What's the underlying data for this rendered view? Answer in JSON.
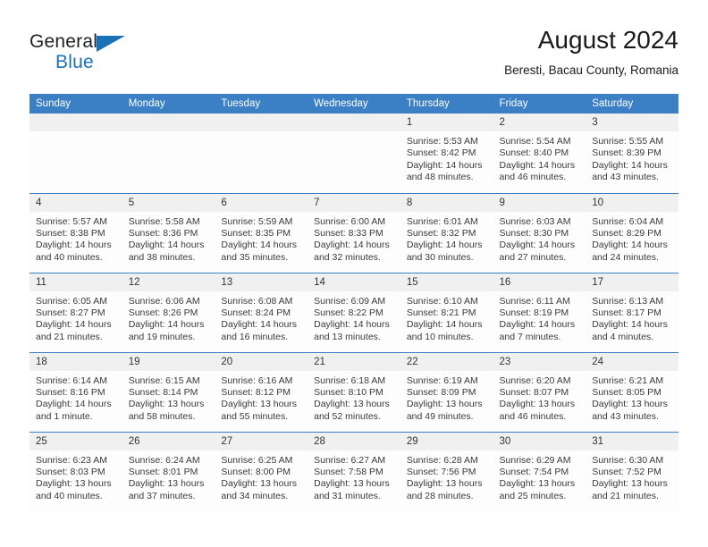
{
  "brand": {
    "name_part1": "General",
    "name_part2": "Blue",
    "accent_color": "#1b72b8"
  },
  "header": {
    "title": "August 2024",
    "subtitle": "Beresti, Bacau County, Romania"
  },
  "calendar": {
    "header_bg": "#3b7fc4",
    "daynum_bg": "#f0f0f0",
    "weekday_headers": [
      "Sunday",
      "Monday",
      "Tuesday",
      "Wednesday",
      "Thursday",
      "Friday",
      "Saturday"
    ],
    "weeks": [
      [
        {
          "day": "",
          "sunrise": "",
          "sunset": "",
          "daylight_line1": "",
          "daylight_line2": ""
        },
        {
          "day": "",
          "sunrise": "",
          "sunset": "",
          "daylight_line1": "",
          "daylight_line2": ""
        },
        {
          "day": "",
          "sunrise": "",
          "sunset": "",
          "daylight_line1": "",
          "daylight_line2": ""
        },
        {
          "day": "",
          "sunrise": "",
          "sunset": "",
          "daylight_line1": "",
          "daylight_line2": ""
        },
        {
          "day": "1",
          "sunrise": "Sunrise: 5:53 AM",
          "sunset": "Sunset: 8:42 PM",
          "daylight_line1": "Daylight: 14 hours",
          "daylight_line2": "and 48 minutes."
        },
        {
          "day": "2",
          "sunrise": "Sunrise: 5:54 AM",
          "sunset": "Sunset: 8:40 PM",
          "daylight_line1": "Daylight: 14 hours",
          "daylight_line2": "and 46 minutes."
        },
        {
          "day": "3",
          "sunrise": "Sunrise: 5:55 AM",
          "sunset": "Sunset: 8:39 PM",
          "daylight_line1": "Daylight: 14 hours",
          "daylight_line2": "and 43 minutes."
        }
      ],
      [
        {
          "day": "4",
          "sunrise": "Sunrise: 5:57 AM",
          "sunset": "Sunset: 8:38 PM",
          "daylight_line1": "Daylight: 14 hours",
          "daylight_line2": "and 40 minutes."
        },
        {
          "day": "5",
          "sunrise": "Sunrise: 5:58 AM",
          "sunset": "Sunset: 8:36 PM",
          "daylight_line1": "Daylight: 14 hours",
          "daylight_line2": "and 38 minutes."
        },
        {
          "day": "6",
          "sunrise": "Sunrise: 5:59 AM",
          "sunset": "Sunset: 8:35 PM",
          "daylight_line1": "Daylight: 14 hours",
          "daylight_line2": "and 35 minutes."
        },
        {
          "day": "7",
          "sunrise": "Sunrise: 6:00 AM",
          "sunset": "Sunset: 8:33 PM",
          "daylight_line1": "Daylight: 14 hours",
          "daylight_line2": "and 32 minutes."
        },
        {
          "day": "8",
          "sunrise": "Sunrise: 6:01 AM",
          "sunset": "Sunset: 8:32 PM",
          "daylight_line1": "Daylight: 14 hours",
          "daylight_line2": "and 30 minutes."
        },
        {
          "day": "9",
          "sunrise": "Sunrise: 6:03 AM",
          "sunset": "Sunset: 8:30 PM",
          "daylight_line1": "Daylight: 14 hours",
          "daylight_line2": "and 27 minutes."
        },
        {
          "day": "10",
          "sunrise": "Sunrise: 6:04 AM",
          "sunset": "Sunset: 8:29 PM",
          "daylight_line1": "Daylight: 14 hours",
          "daylight_line2": "and 24 minutes."
        }
      ],
      [
        {
          "day": "11",
          "sunrise": "Sunrise: 6:05 AM",
          "sunset": "Sunset: 8:27 PM",
          "daylight_line1": "Daylight: 14 hours",
          "daylight_line2": "and 21 minutes."
        },
        {
          "day": "12",
          "sunrise": "Sunrise: 6:06 AM",
          "sunset": "Sunset: 8:26 PM",
          "daylight_line1": "Daylight: 14 hours",
          "daylight_line2": "and 19 minutes."
        },
        {
          "day": "13",
          "sunrise": "Sunrise: 6:08 AM",
          "sunset": "Sunset: 8:24 PM",
          "daylight_line1": "Daylight: 14 hours",
          "daylight_line2": "and 16 minutes."
        },
        {
          "day": "14",
          "sunrise": "Sunrise: 6:09 AM",
          "sunset": "Sunset: 8:22 PM",
          "daylight_line1": "Daylight: 14 hours",
          "daylight_line2": "and 13 minutes."
        },
        {
          "day": "15",
          "sunrise": "Sunrise: 6:10 AM",
          "sunset": "Sunset: 8:21 PM",
          "daylight_line1": "Daylight: 14 hours",
          "daylight_line2": "and 10 minutes."
        },
        {
          "day": "16",
          "sunrise": "Sunrise: 6:11 AM",
          "sunset": "Sunset: 8:19 PM",
          "daylight_line1": "Daylight: 14 hours",
          "daylight_line2": "and 7 minutes."
        },
        {
          "day": "17",
          "sunrise": "Sunrise: 6:13 AM",
          "sunset": "Sunset: 8:17 PM",
          "daylight_line1": "Daylight: 14 hours",
          "daylight_line2": "and 4 minutes."
        }
      ],
      [
        {
          "day": "18",
          "sunrise": "Sunrise: 6:14 AM",
          "sunset": "Sunset: 8:16 PM",
          "daylight_line1": "Daylight: 14 hours",
          "daylight_line2": "and 1 minute."
        },
        {
          "day": "19",
          "sunrise": "Sunrise: 6:15 AM",
          "sunset": "Sunset: 8:14 PM",
          "daylight_line1": "Daylight: 13 hours",
          "daylight_line2": "and 58 minutes."
        },
        {
          "day": "20",
          "sunrise": "Sunrise: 6:16 AM",
          "sunset": "Sunset: 8:12 PM",
          "daylight_line1": "Daylight: 13 hours",
          "daylight_line2": "and 55 minutes."
        },
        {
          "day": "21",
          "sunrise": "Sunrise: 6:18 AM",
          "sunset": "Sunset: 8:10 PM",
          "daylight_line1": "Daylight: 13 hours",
          "daylight_line2": "and 52 minutes."
        },
        {
          "day": "22",
          "sunrise": "Sunrise: 6:19 AM",
          "sunset": "Sunset: 8:09 PM",
          "daylight_line1": "Daylight: 13 hours",
          "daylight_line2": "and 49 minutes."
        },
        {
          "day": "23",
          "sunrise": "Sunrise: 6:20 AM",
          "sunset": "Sunset: 8:07 PM",
          "daylight_line1": "Daylight: 13 hours",
          "daylight_line2": "and 46 minutes."
        },
        {
          "day": "24",
          "sunrise": "Sunrise: 6:21 AM",
          "sunset": "Sunset: 8:05 PM",
          "daylight_line1": "Daylight: 13 hours",
          "daylight_line2": "and 43 minutes."
        }
      ],
      [
        {
          "day": "25",
          "sunrise": "Sunrise: 6:23 AM",
          "sunset": "Sunset: 8:03 PM",
          "daylight_line1": "Daylight: 13 hours",
          "daylight_line2": "and 40 minutes."
        },
        {
          "day": "26",
          "sunrise": "Sunrise: 6:24 AM",
          "sunset": "Sunset: 8:01 PM",
          "daylight_line1": "Daylight: 13 hours",
          "daylight_line2": "and 37 minutes."
        },
        {
          "day": "27",
          "sunrise": "Sunrise: 6:25 AM",
          "sunset": "Sunset: 8:00 PM",
          "daylight_line1": "Daylight: 13 hours",
          "daylight_line2": "and 34 minutes."
        },
        {
          "day": "28",
          "sunrise": "Sunrise: 6:27 AM",
          "sunset": "Sunset: 7:58 PM",
          "daylight_line1": "Daylight: 13 hours",
          "daylight_line2": "and 31 minutes."
        },
        {
          "day": "29",
          "sunrise": "Sunrise: 6:28 AM",
          "sunset": "Sunset: 7:56 PM",
          "daylight_line1": "Daylight: 13 hours",
          "daylight_line2": "and 28 minutes."
        },
        {
          "day": "30",
          "sunrise": "Sunrise: 6:29 AM",
          "sunset": "Sunset: 7:54 PM",
          "daylight_line1": "Daylight: 13 hours",
          "daylight_line2": "and 25 minutes."
        },
        {
          "day": "31",
          "sunrise": "Sunrise: 6:30 AM",
          "sunset": "Sunset: 7:52 PM",
          "daylight_line1": "Daylight: 13 hours",
          "daylight_line2": "and 21 minutes."
        }
      ]
    ]
  }
}
